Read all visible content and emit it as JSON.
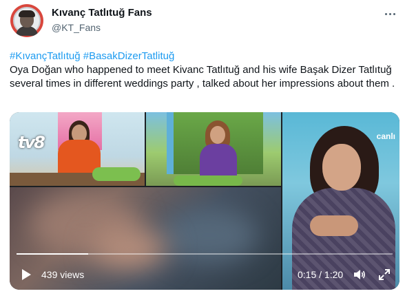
{
  "author": {
    "name": "Kıvanç Tatlıtuğ Fans",
    "handle": "@KT_Fans"
  },
  "tweet": {
    "hashtags": [
      "#KıvançTatlıtuğ",
      "#BasakDizerTatlituğ"
    ],
    "body": "Oya Doğan who happened to meet Kivanc Tatlıtuğ and his wife Başak Dizer Tatlıtuğ several times in different weddings party , talked about her impressions about them ."
  },
  "video": {
    "channel_logo": "tv8",
    "brand_tag": "canlı",
    "views": "439 views",
    "time": "0:15 / 1:20",
    "progress": 0.19
  },
  "icons": {
    "more": "more-icon",
    "play": "play-icon",
    "volume": "volume-icon",
    "fullscreen": "fullscreen-icon"
  },
  "colors": {
    "link": "#1d9bf0",
    "text": "#0f1419",
    "secondary": "#536471"
  }
}
